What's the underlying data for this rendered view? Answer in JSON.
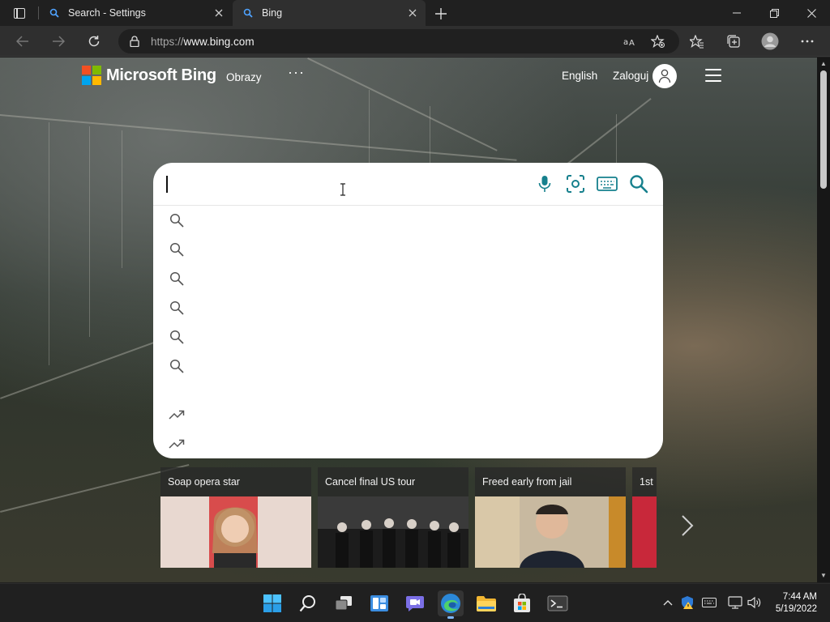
{
  "browser": {
    "tabs": [
      {
        "title": "Search - Settings",
        "active": false
      },
      {
        "title": "Bing",
        "active": true
      }
    ],
    "address": {
      "protocol": "https://",
      "host": "www.bing.com"
    }
  },
  "bing": {
    "brand": "Microsoft Bing",
    "nav": {
      "images": "Obrazy",
      "more": "···",
      "language": "English",
      "signin": "Zaloguj"
    },
    "search": {
      "value": "",
      "history_suggestions": [
        "",
        "",
        "",
        "",
        "",
        ""
      ],
      "trending_suggestions": [
        "",
        ""
      ]
    },
    "news_cards": [
      {
        "title": "Soap opera star"
      },
      {
        "title": "Cancel final US tour"
      },
      {
        "title": "Freed early from jail"
      },
      {
        "title": "1st"
      }
    ]
  },
  "taskbar": {
    "apps": [
      "start-icon",
      "search-icon",
      "task-view-icon",
      "widgets-icon",
      "chat-icon",
      "edge-icon",
      "file-explorer-icon",
      "store-icon",
      "terminal-icon"
    ],
    "time": "7:44 AM",
    "date": "5/19/2022"
  },
  "colors": {
    "ms_red": "#f25022",
    "ms_green": "#7fba00",
    "ms_blue": "#00a4ef",
    "ms_yellow": "#ffb900",
    "bing_teal": "#16808d",
    "edge_blue": "#2b88d8"
  }
}
